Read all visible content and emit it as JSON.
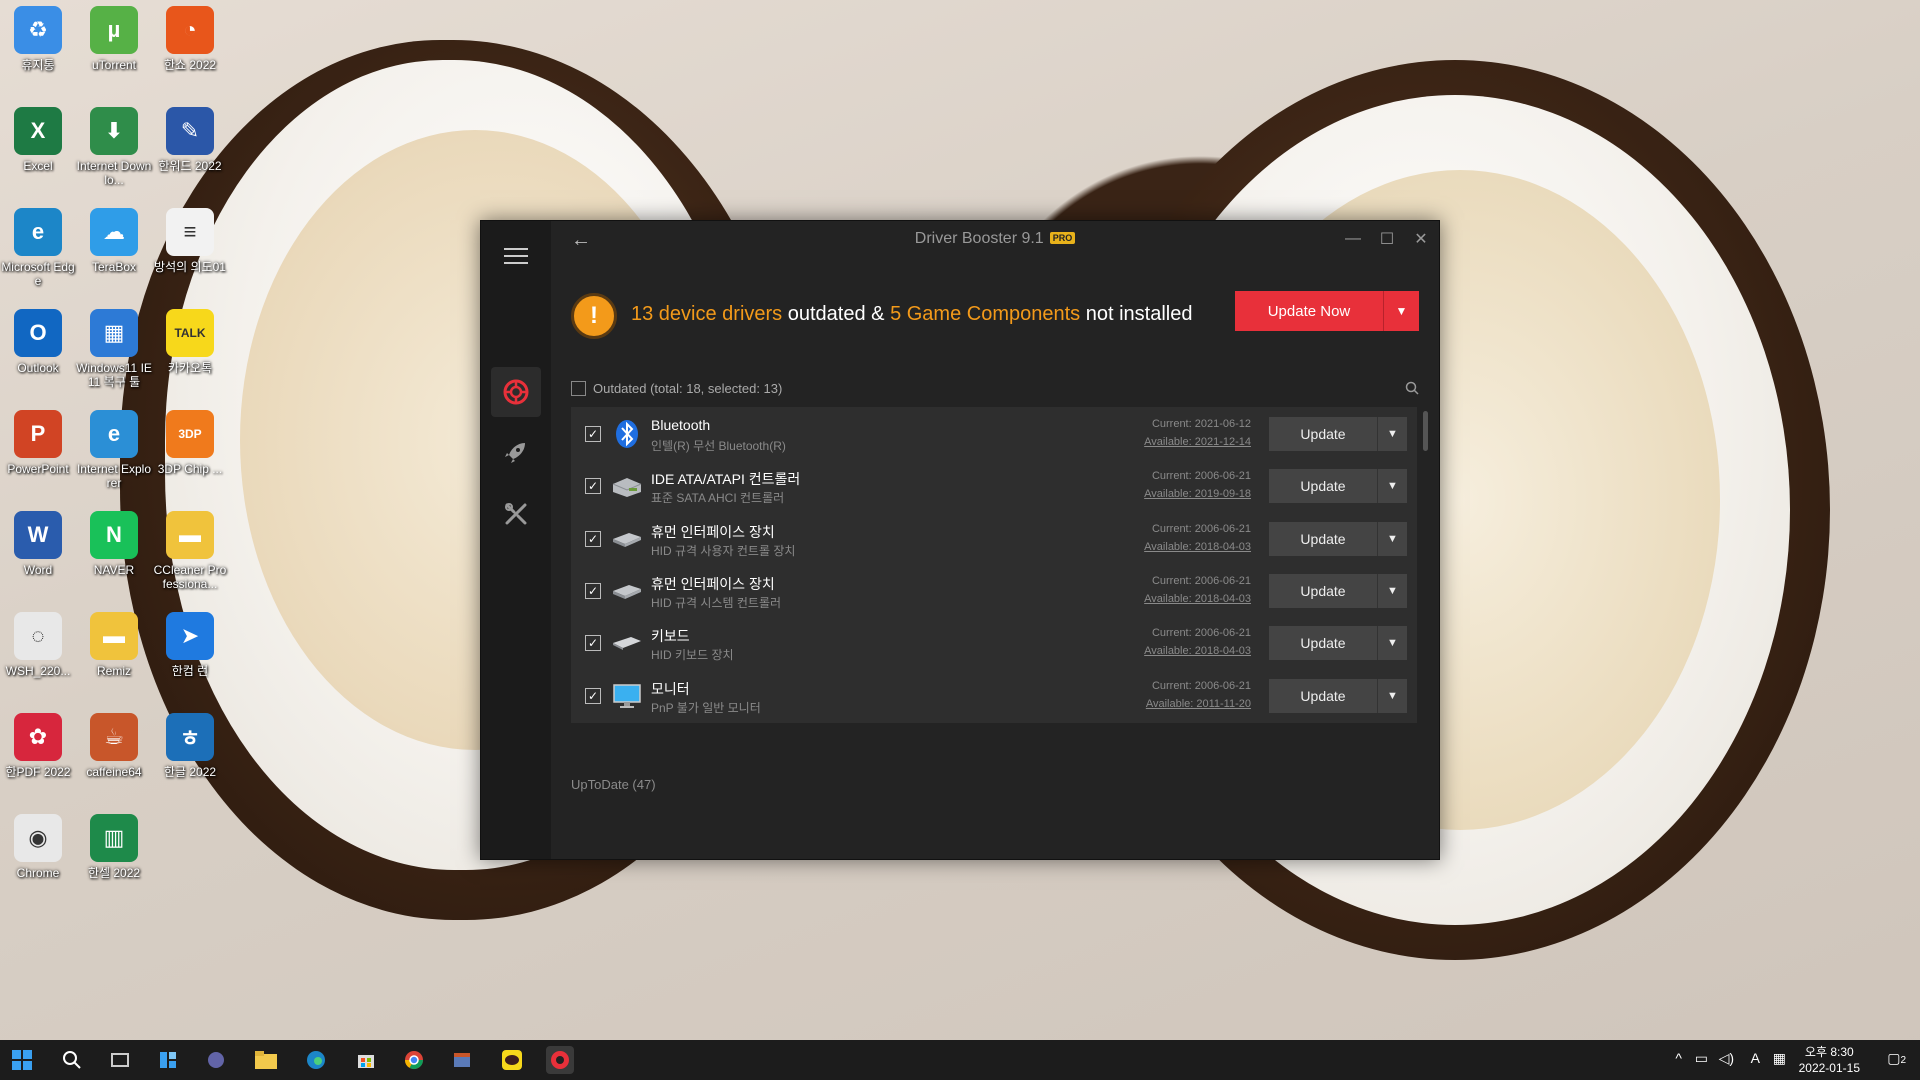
{
  "desktop": {
    "icons": [
      {
        "label": "휴지통",
        "color": "#3a8ee6",
        "glyph": "♻"
      },
      {
        "label": "uTorrent",
        "color": "#56b146",
        "glyph": "µ"
      },
      {
        "label": "한쇼 2022",
        "color": "#e8561b",
        "glyph": "◔"
      },
      {
        "label": "Excel",
        "color": "#1e7a44",
        "glyph": "X"
      },
      {
        "label": "Internet Downlo...",
        "color": "#2f8d4a",
        "glyph": "⬇"
      },
      {
        "label": "한워드 2022",
        "color": "#2b57a8",
        "glyph": "✎"
      },
      {
        "label": "Microsoft Edge",
        "color": "#1c86c8",
        "glyph": "e"
      },
      {
        "label": "TeraBox",
        "color": "#2f9de8",
        "glyph": "☁"
      },
      {
        "label": "방석의 의도01",
        "color": "#f2f2f2",
        "glyph": "≡"
      },
      {
        "label": "Outlook",
        "color": "#1167c2",
        "glyph": "O"
      },
      {
        "label": "Windows11 IE11 복구 툴",
        "color": "#2d7ad6",
        "glyph": "▦"
      },
      {
        "label": "카카오톡",
        "color": "#f7d81b",
        "glyph": "TALK"
      },
      {
        "label": "PowerPoint",
        "color": "#d14424",
        "glyph": "P"
      },
      {
        "label": "Internet Explorer",
        "color": "#2b8fd6",
        "glyph": "e"
      },
      {
        "label": "3DP Chip ...",
        "color": "#f07a1c",
        "glyph": "3DP"
      },
      {
        "label": "Word",
        "color": "#2a5cad",
        "glyph": "W"
      },
      {
        "label": "NAVER",
        "color": "#19c159",
        "glyph": "N"
      },
      {
        "label": "CCleaner Professiona...",
        "color": "#f0c33c",
        "glyph": "▬"
      },
      {
        "label": "WSH_220...",
        "color": "#e8e8e8",
        "glyph": "◌"
      },
      {
        "label": "Remiz",
        "color": "#f0c33c",
        "glyph": "▬"
      },
      {
        "label": "한컴 런",
        "color": "#1f7ae0",
        "glyph": "➤"
      },
      {
        "label": "한PDF 2022",
        "color": "#d7263d",
        "glyph": "✿"
      },
      {
        "label": "caffeine64",
        "color": "#c8562a",
        "glyph": "☕"
      },
      {
        "label": "한글 2022",
        "color": "#1c6fb8",
        "glyph": "ㅎ"
      },
      {
        "label": "Chrome",
        "color": "#e8e8e8",
        "glyph": "◉"
      },
      {
        "label": "한셀 2022",
        "color": "#1e8a4a",
        "glyph": "▥"
      }
    ]
  },
  "app": {
    "title": "Driver Booster 9.1",
    "pro_badge": "PRO",
    "banner": {
      "outdated_count_text": "13 device drivers",
      "mid_text": " outdated & ",
      "game_text": "5 Game Components",
      "end_text": " not installed",
      "update_now_label": "Update Now",
      "accent_color": "#f39a1a",
      "button_color": "#e8303a"
    },
    "list_header": "Outdated (total: 18, selected: 13)",
    "rows": [
      {
        "name": "Bluetooth",
        "desc": "인텔(R) 무선 Bluetooth(R)",
        "current": "Current: 2021-06-12",
        "available": "Available: 2021-12-14",
        "icon": "bluetooth-icon",
        "checked": "✓",
        "update_label": "Update"
      },
      {
        "name": "IDE ATA/ATAPI 컨트롤러",
        "desc": "표준 SATA AHCI 컨트롤러",
        "current": "Current: 2006-06-21",
        "available": "Available: 2019-09-18",
        "icon": "disk-controller-icon",
        "checked": "✓",
        "update_label": "Update"
      },
      {
        "name": "휴먼 인터페이스 장치",
        "desc": "HID 규격 사용자 컨트롤 장치",
        "current": "Current: 2006-06-21",
        "available": "Available: 2018-04-03",
        "icon": "hid-device-icon",
        "checked": "✓",
        "update_label": "Update"
      },
      {
        "name": "휴먼 인터페이스 장치",
        "desc": "HID 규격 시스템 컨트롤러",
        "current": "Current: 2006-06-21",
        "available": "Available: 2018-04-03",
        "icon": "hid-device-icon",
        "checked": "✓",
        "update_label": "Update"
      },
      {
        "name": "키보드",
        "desc": "HID 키보드 장치",
        "current": "Current: 2006-06-21",
        "available": "Available: 2018-04-03",
        "icon": "keyboard-icon",
        "checked": "✓",
        "update_label": "Update"
      },
      {
        "name": "모니터",
        "desc": "PnP 불가 일반 모니터",
        "current": "Current: 2006-06-21",
        "available": "Available: 2011-11-20",
        "icon": "monitor-icon",
        "checked": "✓",
        "update_label": "Update"
      }
    ],
    "uptodate": "UpToDate (47)"
  },
  "taskbar": {
    "time": "오후 8:30",
    "date": "2022-01-15",
    "ime": "A",
    "notification_count": "2"
  }
}
